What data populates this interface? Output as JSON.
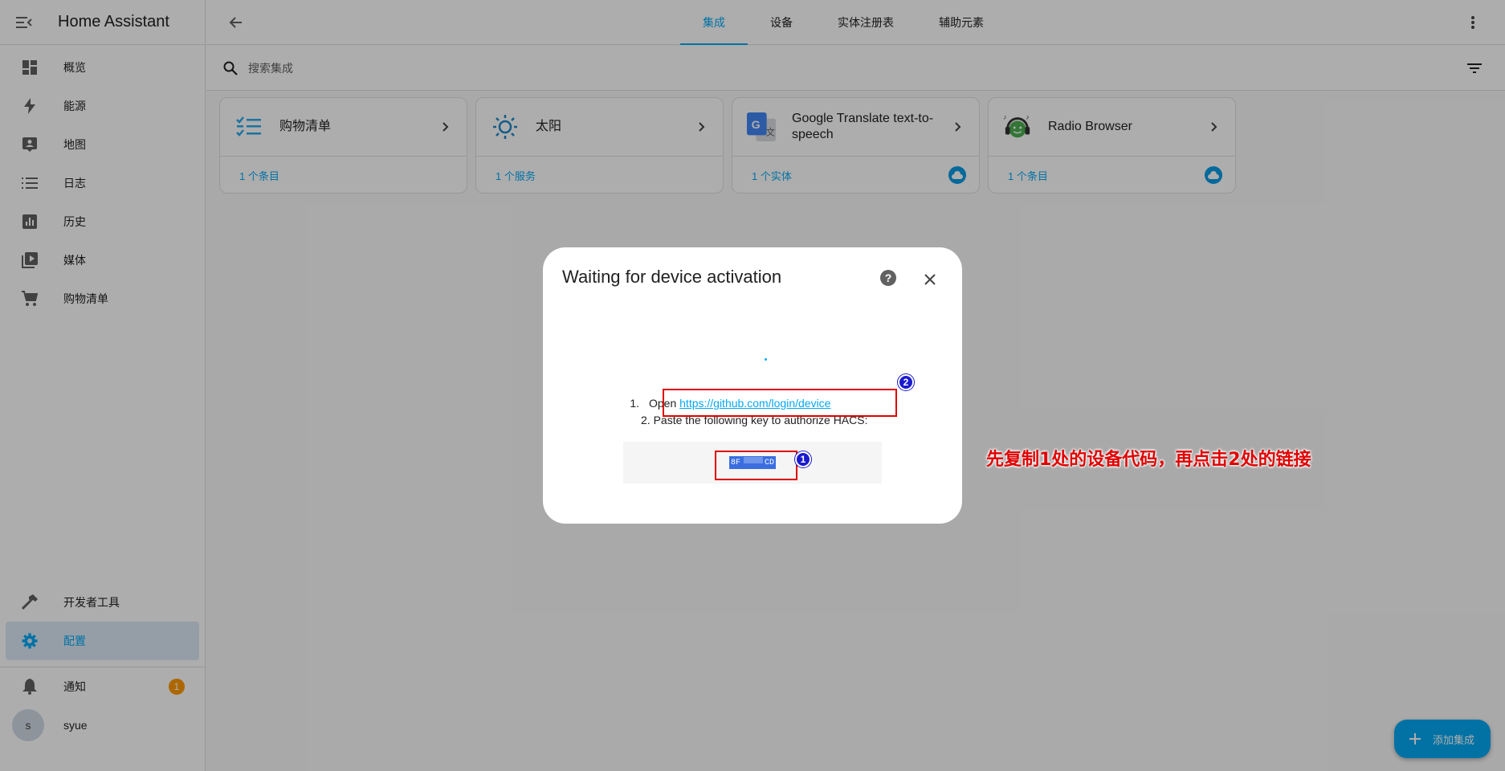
{
  "sidebar": {
    "title": "Home Assistant",
    "items": [
      {
        "label": "概览",
        "icon": "dashboard-icon"
      },
      {
        "label": "能源",
        "icon": "lightning-icon"
      },
      {
        "label": "地图",
        "icon": "map-account-icon"
      },
      {
        "label": "日志",
        "icon": "list-icon"
      },
      {
        "label": "历史",
        "icon": "chart-box-icon"
      },
      {
        "label": "媒体",
        "icon": "media-play-icon"
      },
      {
        "label": "购物清单",
        "icon": "cart-icon"
      }
    ],
    "dev_tools": "开发者工具",
    "config": "配置",
    "notifications": "通知",
    "notifications_count": "1",
    "user_initial": "s",
    "user_name": "syue"
  },
  "topbar": {
    "tabs": [
      "集成",
      "设备",
      "实体注册表",
      "辅助元素"
    ],
    "active_tab": "集成"
  },
  "search": {
    "placeholder": "搜索集成"
  },
  "cards": [
    {
      "name": "购物清单",
      "footer": "1 个条目",
      "logo": "checklist-icon",
      "cloud": false
    },
    {
      "name": "太阳",
      "footer": "1 个服务",
      "logo": "sun-icon",
      "cloud": false
    },
    {
      "name": "Google Translate text-to-speech",
      "footer": "1 个实体",
      "logo": "google-translate-icon",
      "cloud": true
    },
    {
      "name": "Radio Browser",
      "footer": "1 个条目",
      "logo": "radio-browser-icon",
      "cloud": true
    }
  ],
  "dialog": {
    "title": "Waiting for device activation",
    "step1_num": "1.",
    "step1_text": "Open",
    "step1_link": "https://github.com/login/device",
    "step2_text": "2. Paste the following key to authorize HACS:",
    "code_left": "8F",
    "code_right": "CD"
  },
  "annotations": {
    "marker1": "1",
    "marker2": "2",
    "note": "先复制1处的设备代码，再点击2处的链接"
  },
  "fab": {
    "label": "添加集成"
  },
  "colors": {
    "accent": "#03a9f4",
    "badge": "#ff9800",
    "annotation": "#e00000"
  }
}
